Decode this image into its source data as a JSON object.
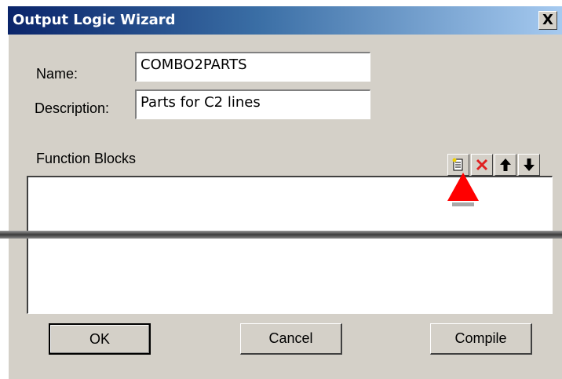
{
  "window": {
    "title": "Output Logic Wizard",
    "close_label": "X"
  },
  "form": {
    "name_label": "Name:",
    "name_value": "COMBO2PARTS",
    "description_label": "Description:",
    "description_value": "Parts for C2 lines"
  },
  "function_blocks": {
    "label": "Function Blocks",
    "toolbar": [
      {
        "icon": "new-block-icon"
      },
      {
        "icon": "delete-x-icon"
      },
      {
        "icon": "arrow-up-icon"
      },
      {
        "icon": "arrow-down-icon"
      }
    ],
    "items": []
  },
  "buttons": {
    "ok": "OK",
    "cancel": "Cancel",
    "compile": "Compile"
  },
  "colors": {
    "dialog_bg": "#d4d0c8",
    "titlebar_start": "#0a246a",
    "titlebar_end": "#a6caf0",
    "delete_red": "#e02020",
    "pointer_red": "#ff0000"
  }
}
